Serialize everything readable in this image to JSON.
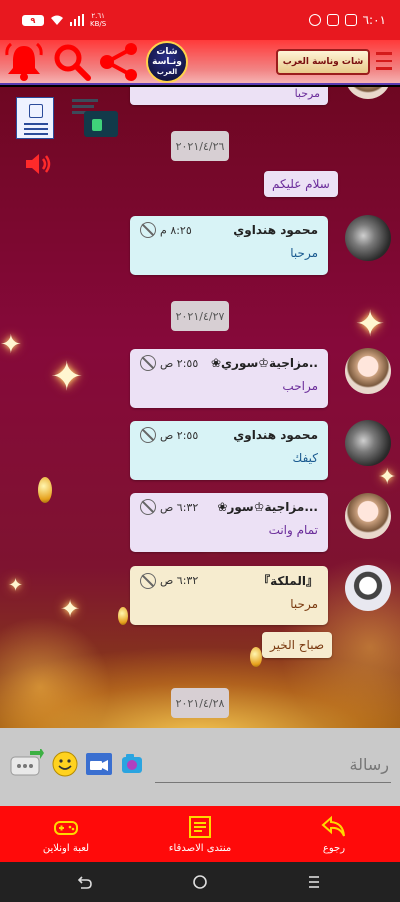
{
  "status_bar": {
    "time": "٦:٠١",
    "battery": "٩",
    "net_speed_value": "٢.٦١",
    "net_speed_unit": "KB/S"
  },
  "top_bar": {
    "logo_text_line1": "شات",
    "logo_text_line2": "ونـاسة",
    "logo_text_line3": "العرب",
    "banner_text": "شات وناسة العرب",
    "icons": [
      "bell-icon",
      "search-icon",
      "share-icon",
      "menu-icon"
    ]
  },
  "chat": {
    "dates": {
      "d1": "٢٠٢١/٤/٢٦",
      "d2": "٢٠٢١/٤/٢٧",
      "d3": "٢٠٢١/٤/٢٨"
    },
    "partial_top_text": "مرحبا",
    "plain_msg_1": "سلام عليكم",
    "messages": [
      {
        "name": "محمود هنداوي",
        "time": "٨:٢٥ م",
        "text": "مرحبا",
        "color": "#d8f3f6"
      },
      {
        "name": "❀مزاجية♔سوري..",
        "time": "٢:٥٥ ص",
        "text": "مراحب",
        "color": "#ece1f5"
      },
      {
        "name": "محمود هنداوي",
        "time": "٢:٥٥ ص",
        "text": "كيفك",
        "color": "#d8f3f6"
      },
      {
        "name": "❀مزاجية♔سور...",
        "time": "٦:٣٢ ص",
        "text": "تمام وانت",
        "color": "#ece1f5"
      },
      {
        "name": "『الملكة』",
        "time": "٦:٣٢ ص",
        "text": "مرحبا",
        "color": "#f6eccf"
      }
    ],
    "plain_msg_2": "صباح الخير"
  },
  "input": {
    "placeholder": "رسالة"
  },
  "bottom_nav": {
    "back_label": "رجوع",
    "forum_label": "منتدى الاصدقاء",
    "game_label": "لعبة اونلاين"
  }
}
